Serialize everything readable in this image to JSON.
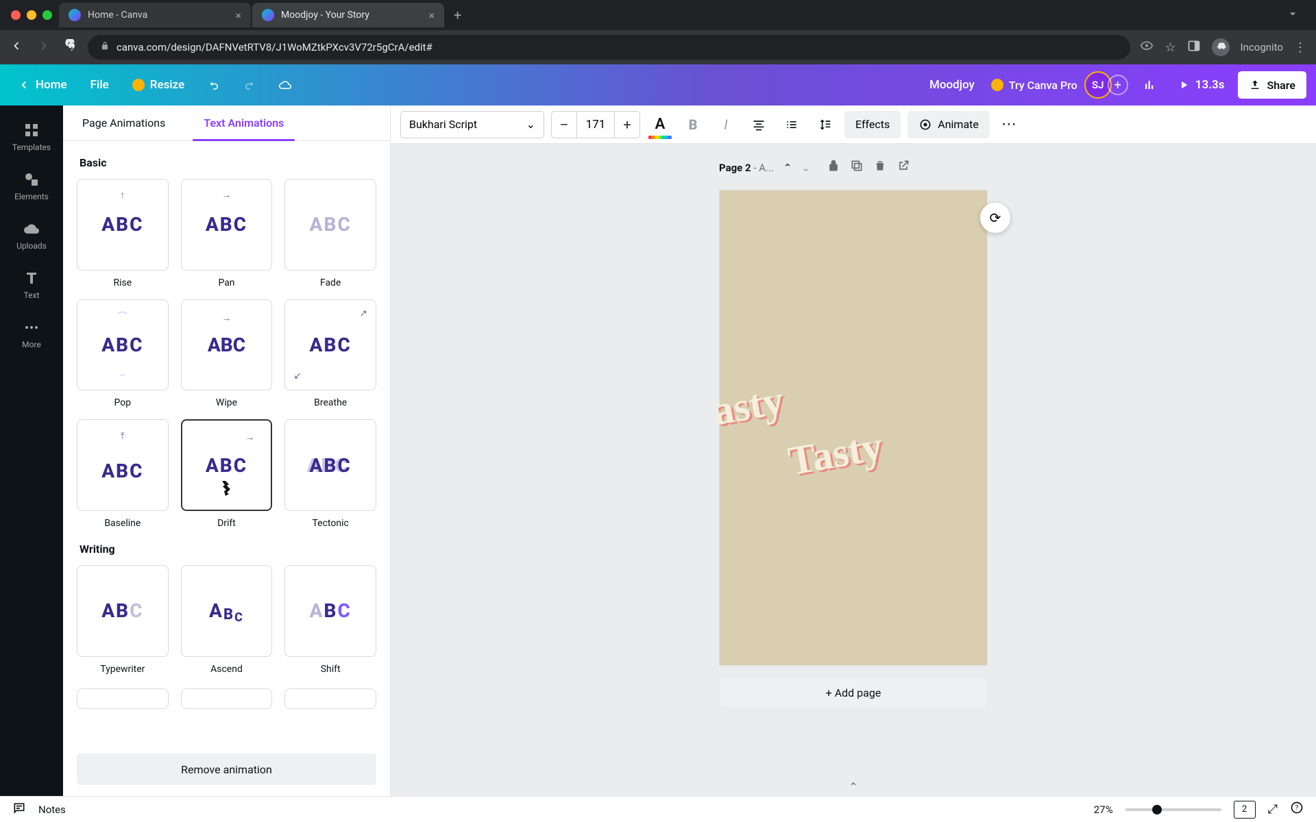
{
  "browser": {
    "tabs": [
      {
        "title": "Home - Canva",
        "favicon": "#00c4cc"
      },
      {
        "title": "Moodjoy - Your Story",
        "favicon": "#00c4cc"
      }
    ],
    "url": "canva.com/design/DAFNVetRTV8/J1WoMZtkPXcv3V72r5gCrA/edit#",
    "profile_label": "Incognito"
  },
  "header": {
    "home": "Home",
    "file": "File",
    "resize": "Resize",
    "doc_title": "Moodjoy",
    "try_pro": "Try Canva Pro",
    "avatar_initials": "SJ",
    "play_duration": "13.3s",
    "share": "Share"
  },
  "rail": [
    {
      "label": "Templates"
    },
    {
      "label": "Elements"
    },
    {
      "label": "Uploads"
    },
    {
      "label": "Text"
    },
    {
      "label": "More"
    }
  ],
  "panel": {
    "tab_page": "Page Animations",
    "tab_text": "Text Animations",
    "sections": [
      {
        "title": "Basic",
        "items": [
          {
            "label": "Rise"
          },
          {
            "label": "Pan"
          },
          {
            "label": "Fade"
          },
          {
            "label": "Pop"
          },
          {
            "label": "Wipe"
          },
          {
            "label": "Breathe"
          },
          {
            "label": "Baseline"
          },
          {
            "label": "Drift",
            "selected": true
          },
          {
            "label": "Tectonic"
          }
        ]
      },
      {
        "title": "Writing",
        "items": [
          {
            "label": "Typewriter"
          },
          {
            "label": "Ascend"
          },
          {
            "label": "Shift"
          }
        ]
      }
    ],
    "remove": "Remove animation"
  },
  "toolbar": {
    "font": "Bukhari Script",
    "size": "171",
    "effects": "Effects",
    "animate": "Animate"
  },
  "page": {
    "label": "Page 2",
    "subtitle": " - A...",
    "text1": "asty",
    "text2": "Tasty",
    "add_page": "+ Add page"
  },
  "bottom": {
    "notes": "Notes",
    "zoom": "27%",
    "page_count": "2"
  }
}
